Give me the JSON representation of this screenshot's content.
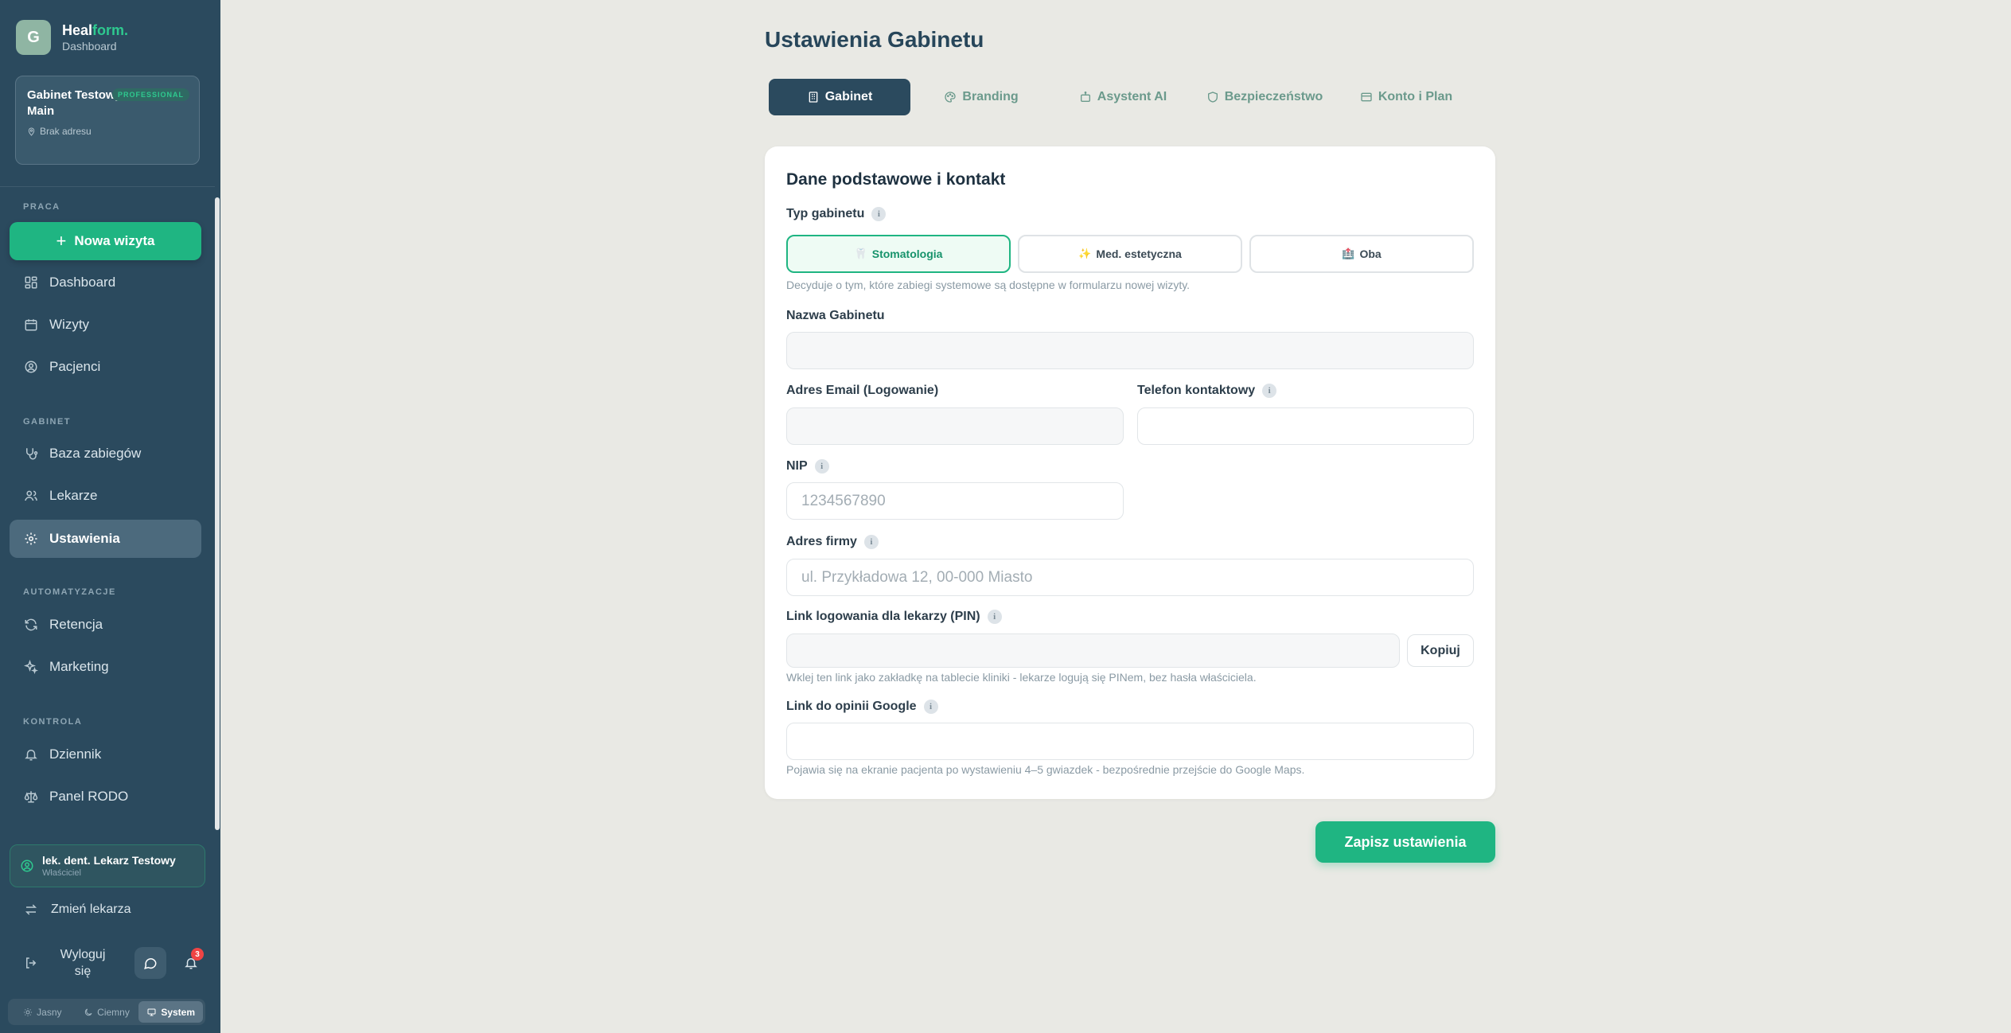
{
  "brand": {
    "initial": "G",
    "name_a": "Heal",
    "name_b": "form.",
    "subtitle": "Dashboard"
  },
  "clinic": {
    "name": "Gabinet Testowy Main",
    "badge": "PROFESSIONAL",
    "address": "Brak adresu"
  },
  "sidebar": {
    "sections": {
      "work": "PRACA",
      "clinic": "GABINET",
      "automation": "AUTOMATYZACJE",
      "control": "KONTROLA"
    },
    "new_visit": "Nowa wizyta",
    "items": {
      "dashboard": "Dashboard",
      "visits": "Wizyty",
      "patients": "Pacjenci",
      "treatments": "Baza zabiegów",
      "doctors": "Lekarze",
      "settings": "Ustawienia",
      "retention": "Retencja",
      "marketing": "Marketing",
      "log": "Dziennik",
      "gdpr": "Panel RODO"
    },
    "active_item": "settings"
  },
  "doctor": {
    "name": "lek. dent. Lekarz Testowy",
    "role": "Właściciel"
  },
  "change_doctor": "Zmień lekarza",
  "logout": {
    "line1": "Wyloguj",
    "line2": "się"
  },
  "notifications_count": "3",
  "theme": {
    "light": "Jasny",
    "dark": "Ciemny",
    "system": "System",
    "selected": "System"
  },
  "page": {
    "title": "Ustawienia Gabinetu"
  },
  "tabs": [
    {
      "label": "Gabinet",
      "icon": "building-icon"
    },
    {
      "label": "Branding",
      "icon": "palette-icon"
    },
    {
      "label": "Asystent AI",
      "icon": "bot-icon"
    },
    {
      "label": "Bezpieczeństwo",
      "icon": "shield-icon"
    },
    {
      "label": "Konto i Plan",
      "icon": "card-icon"
    }
  ],
  "active_tab": "Gabinet",
  "form": {
    "title": "Dane podstawowe i kontakt",
    "type_label": "Typ gabinetu",
    "types": [
      {
        "label": "Stomatologia",
        "emoji": "🦷"
      },
      {
        "label": "Med. estetyczna",
        "emoji": "✨"
      },
      {
        "label": "Oba",
        "emoji": "🏥"
      }
    ],
    "selected_type": "Stomatologia",
    "type_hint": "Decyduje o tym, które zabiegi systemowe są dostępne w formularzu nowej wizyty.",
    "name_label": "Nazwa Gabinetu",
    "name_value": "",
    "email_label": "Adres Email (Logowanie)",
    "email_value": "",
    "phone_label": "Telefon kontaktowy",
    "phone_value": "",
    "nip_label": "NIP",
    "nip_placeholder": "1234567890",
    "address_label": "Adres firmy",
    "address_placeholder": "ul. Przykładowa 12, 00-000 Miasto",
    "pin_link_label": "Link logowania dla lekarzy (PIN)",
    "pin_link_value": "",
    "copy_label": "Kopiuj",
    "pin_hint": "Wklej ten link jako zakładkę na tablecie kliniki - lekarze logują się PINem, bez hasła właściciela.",
    "google_label": "Link do opinii Google",
    "google_value": "",
    "google_hint": "Pojawia się na ekranie pacjenta po wystawieniu 4–5 gwiazdek - bezpośrednie przejście do Google Maps."
  },
  "save_label": "Zapisz ustawienia",
  "colors": {
    "sidebar": "#2b4a5e",
    "accent": "#1fb582",
    "background": "#e9e9e4"
  }
}
